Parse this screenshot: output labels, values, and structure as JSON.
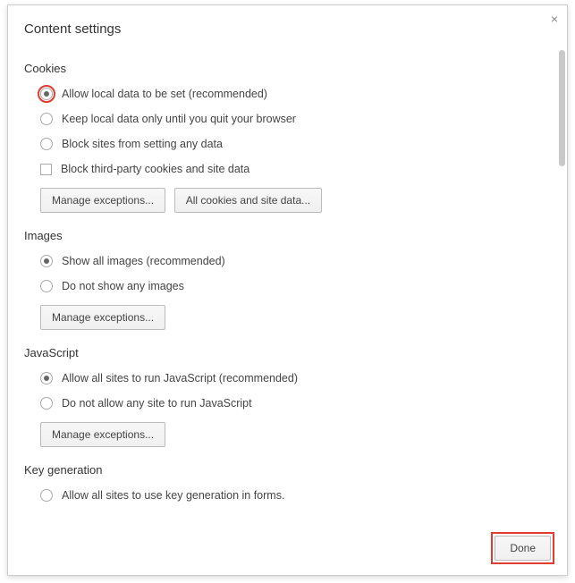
{
  "dialog": {
    "title": "Content settings",
    "close_label": "×",
    "done_label": "Done"
  },
  "sections": {
    "cookies": {
      "title": "Cookies",
      "options": [
        {
          "label": "Allow local data to be set (recommended)",
          "checked": true,
          "highlighted": true
        },
        {
          "label": "Keep local data only until you quit your browser",
          "checked": false
        },
        {
          "label": "Block sites from setting any data",
          "checked": false
        }
      ],
      "checkbox": {
        "label": "Block third-party cookies and site data",
        "checked": false
      },
      "buttons": {
        "manage": "Manage exceptions...",
        "all_cookies": "All cookies and site data..."
      }
    },
    "images": {
      "title": "Images",
      "options": [
        {
          "label": "Show all images (recommended)",
          "checked": true
        },
        {
          "label": "Do not show any images",
          "checked": false
        }
      ],
      "buttons": {
        "manage": "Manage exceptions..."
      }
    },
    "javascript": {
      "title": "JavaScript",
      "options": [
        {
          "label": "Allow all sites to run JavaScript (recommended)",
          "checked": true
        },
        {
          "label": "Do not allow any site to run JavaScript",
          "checked": false
        }
      ],
      "buttons": {
        "manage": "Manage exceptions..."
      }
    },
    "keygen": {
      "title": "Key generation",
      "options": [
        {
          "label": "Allow all sites to use key generation in forms.",
          "checked": false
        }
      ]
    }
  }
}
